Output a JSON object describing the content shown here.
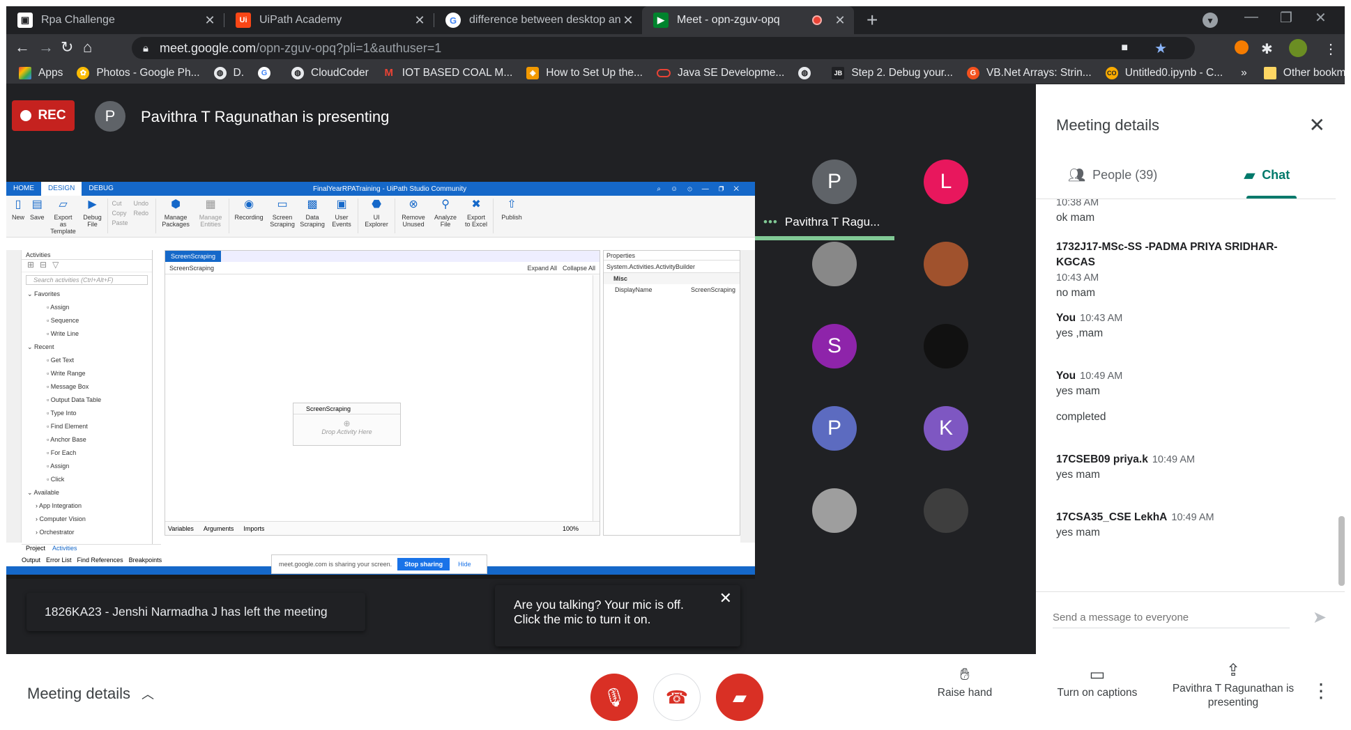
{
  "browser": {
    "tabs": [
      {
        "title": "Rpa Challenge",
        "favicon": "robot-icon"
      },
      {
        "title": "UiPath Academy",
        "favicon": "uipath-icon"
      },
      {
        "title": "difference between desktop and",
        "favicon": "google-icon"
      },
      {
        "title": "Meet - opn-zguv-opq",
        "favicon": "meet-icon"
      }
    ],
    "url_main": "meet.google.com",
    "url_rest": "/opn-zguv-opq?pli=1&authuser=1",
    "bookmarks": [
      {
        "label": "Apps"
      },
      {
        "label": "Photos - Google Ph..."
      },
      {
        "label": "D."
      },
      {
        "label": ""
      },
      {
        "label": "CloudCoder"
      },
      {
        "label": "IOT BASED COAL M..."
      },
      {
        "label": "How to Set Up the..."
      },
      {
        "label": "Java SE Developme..."
      },
      {
        "label": ""
      },
      {
        "label": "Step 2. Debug your..."
      },
      {
        "label": "VB.Net Arrays: Strin..."
      },
      {
        "label": "Untitled0.ipynb - C..."
      }
    ],
    "bookmarks_more": "»",
    "other_bookmarks": "Other bookmarks"
  },
  "meet": {
    "rec_label": "REC",
    "presenter_initial": "P",
    "presenter_text": "Pavithra T Ragunathan is presenting",
    "toast_left": "1826KA23 - Jenshi Narmadha J has left the meeting",
    "toast_mic": "Are you talking? Your mic is off. Click the mic to turn it on.",
    "participant_name": "Pavithra T Ragu...",
    "participants": [
      {
        "initial": "P",
        "color": "#5f6368"
      },
      {
        "initial": "L",
        "color": "#e8175d"
      },
      {
        "initial": "",
        "color": "#888888"
      },
      {
        "initial": "",
        "color": "#a0522d"
      },
      {
        "initial": "S",
        "color": "#8e24aa"
      },
      {
        "initial": "",
        "color": "#111111"
      },
      {
        "initial": "P",
        "color": "#5c6bc0"
      },
      {
        "initial": "K",
        "color": "#7e57c2"
      },
      {
        "initial": "",
        "color": "#9e9e9e"
      },
      {
        "initial": "",
        "color": "#3e3e3e"
      }
    ]
  },
  "uipath": {
    "ribbon_tabs": [
      "HOME",
      "DESIGN",
      "DEBUG"
    ],
    "window_title": "FinalYearRPATraining - UiPath Studio Community",
    "ribbon_buttons": [
      "New",
      "Save",
      "Export as Template",
      "Debug File",
      "Cut",
      "Copy",
      "Paste",
      "Undo",
      "Redo",
      "Manage Packages",
      "Manage Entities",
      "Recording",
      "Screen Scraping",
      "Data Scraping",
      "User Events",
      "UI Explorer",
      "Remove Unused",
      "Analyze File",
      "Export to Excel",
      "Publish"
    ],
    "activities_header": "Activities",
    "search_placeholder": "Search activities (Ctrl+Alt+F)",
    "activity_items": [
      "Favorites",
      "Assign",
      "Sequence",
      "Write Line",
      "Recent",
      "Get Text",
      "Write Range",
      "Message Box",
      "Output Data Table",
      "Type Into",
      "Find Element",
      "Anchor Base",
      "For Each",
      "Assign",
      "Click",
      "Available",
      "App Integration",
      "Computer Vision",
      "Orchestrator"
    ],
    "designer_tab": "ScreenScraping",
    "designer_breadcrumb": "ScreenScraping",
    "expand_all": "Expand All",
    "collapse_all": "Collapse All",
    "seq_title": "ScreenScraping",
    "drop_hint": "Drop Activity Here",
    "props_header": "Properties",
    "props_class": "System.Activities.ActivityBuilder",
    "props_section": "Misc",
    "props_key": "DisplayName",
    "props_val": "ScreenScraping",
    "bottom_tabs": [
      "Variables",
      "Arguments",
      "Imports"
    ],
    "zoom": "100%",
    "panel_tabs": [
      "Project",
      "Activities"
    ],
    "output_tabs": [
      "Output",
      "Error List",
      "Find References",
      "Breakpoints"
    ],
    "share_text": "meet.google.com is sharing your screen.",
    "stop_sharing": "Stop sharing",
    "hide": "Hide"
  },
  "panel": {
    "title": "Meeting details",
    "people_tab": "People (39)",
    "chat_tab": "Chat",
    "messages": [
      {
        "sender": "",
        "time": "10:38 AM",
        "text": "ok mam"
      },
      {
        "sender": "1732J17-MSc-SS -PADMA PRIYA SRIDHAR-KGCAS",
        "time": "10:43 AM",
        "text": "no mam"
      },
      {
        "sender": "You",
        "time": "10:43 AM",
        "text": "yes ,mam"
      },
      {
        "sender": "You",
        "time": "10:49 AM",
        "text": "yes mam",
        "text2": "completed"
      },
      {
        "sender": "17CSEB09 priya.k",
        "time": "10:49 AM",
        "text": "yes mam"
      },
      {
        "sender": "17CSA35_CSE LekhA",
        "time": "10:49 AM",
        "text": "yes mam"
      }
    ],
    "send_placeholder": "Send a message to everyone"
  },
  "bottom": {
    "meeting_details": "Meeting details",
    "raise_hand": "Raise hand",
    "captions": "Turn on captions",
    "presenting": "Pavithra T Ragunathan is presenting"
  },
  "colors": {
    "rec": "#c5221f",
    "chat_accent": "#00796b",
    "hangup_red": "#d93025"
  }
}
